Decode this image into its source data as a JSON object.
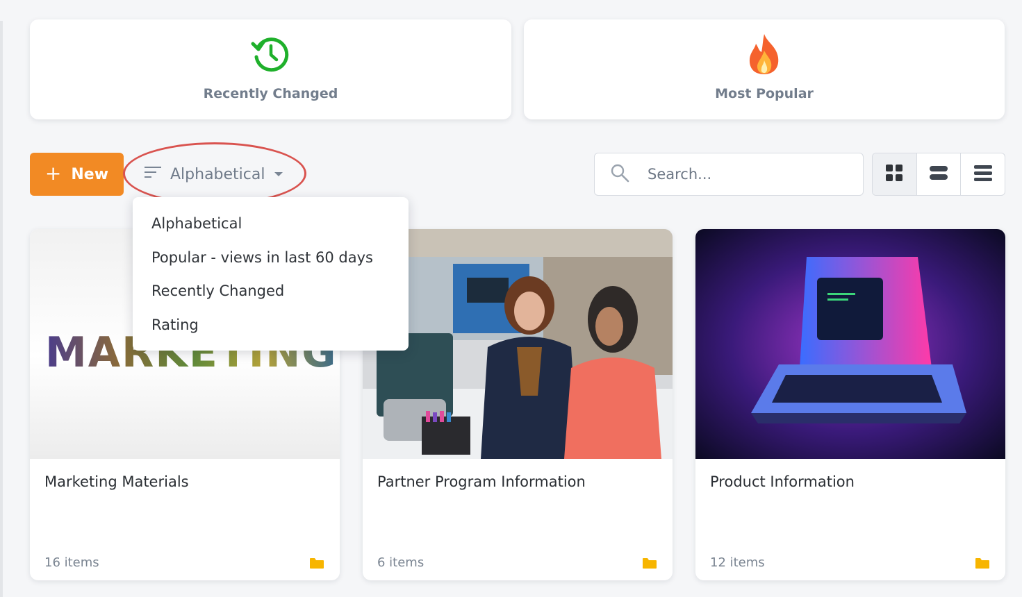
{
  "quick_filters": [
    {
      "label": "Recently Changed",
      "icon": "history-clock-icon",
      "color": "#1fb02b"
    },
    {
      "label": "Most Popular",
      "icon": "flame-icon",
      "color": "#f55a2a"
    }
  ],
  "toolbar": {
    "new_label": "New",
    "new_icon": "plus",
    "sort_label": "Alphabetical",
    "search_placeholder": "Search...",
    "accent": "#f28a24"
  },
  "sort_menu": {
    "items": [
      {
        "label": "Alphabetical"
      },
      {
        "label": "Popular - views in last 60 days"
      },
      {
        "label": "Recently Changed"
      },
      {
        "label": "Rating"
      }
    ]
  },
  "view_modes": [
    {
      "name": "grid",
      "active": true
    },
    {
      "name": "list-compact",
      "active": false
    },
    {
      "name": "list",
      "active": false
    }
  ],
  "folders": [
    {
      "title": "Marketing Materials",
      "count": "16 items",
      "thumb_text": "MARKETING"
    },
    {
      "title": "Partner Program Information",
      "count": "6 items"
    },
    {
      "title": "Product Information",
      "count": "12 items"
    }
  ],
  "colors": {
    "folder": "#f7b500",
    "highlight": "#d9534f"
  }
}
